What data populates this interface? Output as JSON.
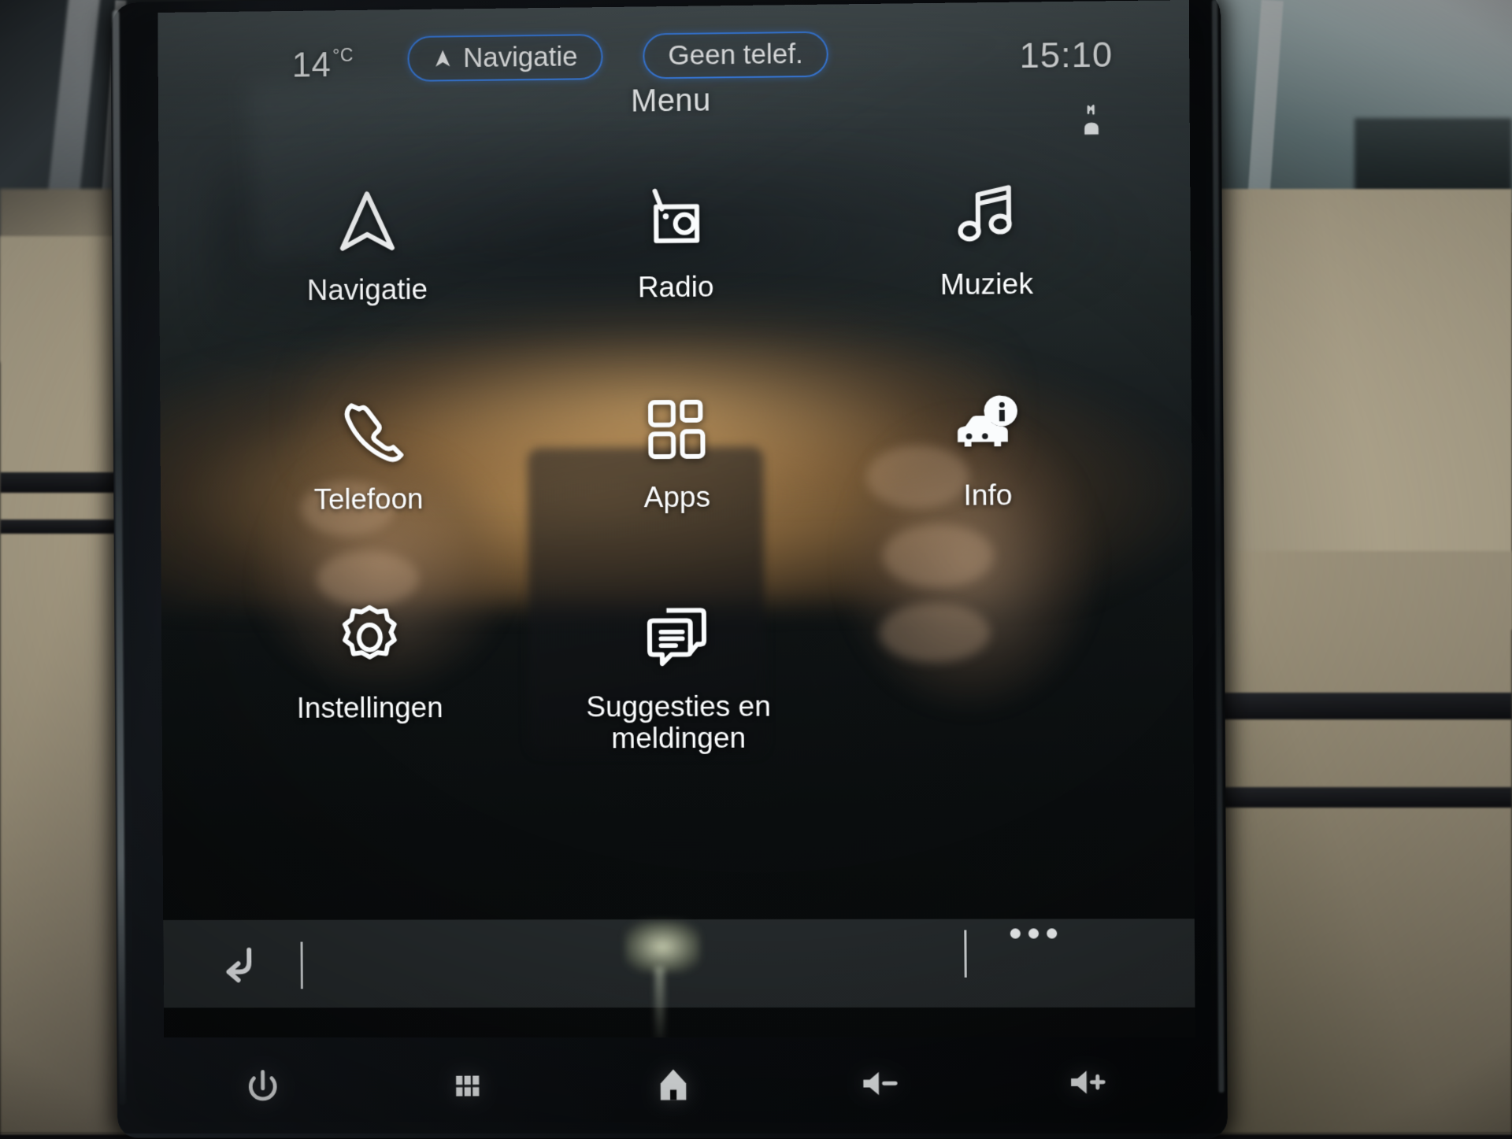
{
  "status_bar": {
    "temperature": "14",
    "temperature_unit": "°C",
    "nav_pill_label": "Navigatie",
    "phone_pill_label": "Geen telef.",
    "clock": "15:10",
    "climate_icon": "defrost-icon",
    "accent_color": "#3e86f0"
  },
  "header": {
    "title": "Menu"
  },
  "menu": {
    "tiles": [
      {
        "label": "Navigatie",
        "icon": "navigation-arrow-icon"
      },
      {
        "label": "Radio",
        "icon": "radio-icon"
      },
      {
        "label": "Muziek",
        "icon": "music-note-icon"
      },
      {
        "label": "Telefoon",
        "icon": "phone-handset-icon"
      },
      {
        "label": "Apps",
        "icon": "apps-grid-icon"
      },
      {
        "label": "Info",
        "icon": "car-info-icon"
      },
      {
        "label": "Instellingen",
        "icon": "gear-icon"
      },
      {
        "label": "Suggesties en meldingen",
        "icon": "message-notification-icon"
      }
    ]
  },
  "toolbar": {
    "back_icon": "back-arrow-icon",
    "overflow_icon": "more-dots-icon"
  },
  "hardware_buttons": [
    {
      "name": "power",
      "icon": "power-icon"
    },
    {
      "name": "apps",
      "icon": "grid-icon"
    },
    {
      "name": "home",
      "icon": "home-icon"
    },
    {
      "name": "volume-down",
      "icon": "volume-down-icon"
    },
    {
      "name": "volume-up",
      "icon": "volume-up-icon"
    }
  ],
  "colors": {
    "screen_text": "#fafcfd",
    "pill_border": "#3e86f0",
    "lcd_top": "#3f484b",
    "lcd_bottom": "#090b0c"
  }
}
